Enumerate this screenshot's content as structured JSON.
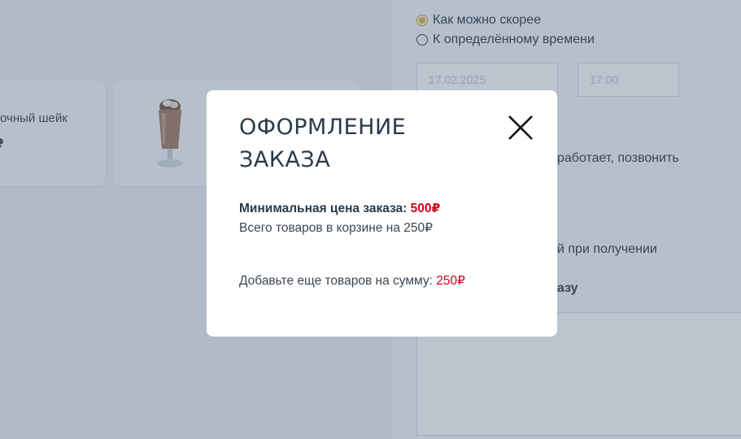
{
  "background": {
    "cards": [
      {
        "name": "очный шейк",
        "price": "₽"
      }
    ],
    "delivery_time": {
      "options": [
        {
          "label": "Как можно скорее",
          "selected": true
        },
        {
          "label": "К определённому времени",
          "selected": false
        }
      ],
      "date_placeholder": "17.02.2025",
      "time_placeholder": "17:00"
    },
    "partial_texts": {
      "callback": "работает, позвонить",
      "payment": "й при получении",
      "comment": "азу"
    }
  },
  "modal": {
    "title": "ОФОРМЛЕНИЕ ЗАКАЗА",
    "min_price_label": "Минимальная цена заказа: ",
    "min_price_value": "500₽",
    "cart_total_text": "Всего товаров в корзине на 250₽",
    "add_more_label": "Добавьте еще товаров на сумму: ",
    "add_more_value": "250₽"
  },
  "colors": {
    "accent_red": "#d0021b",
    "radio_accent": "#e0b52b",
    "overlay": "rgba(70,92,120,0.36)"
  },
  "icons": {
    "close": "close-icon",
    "product": "milkshake-image"
  }
}
